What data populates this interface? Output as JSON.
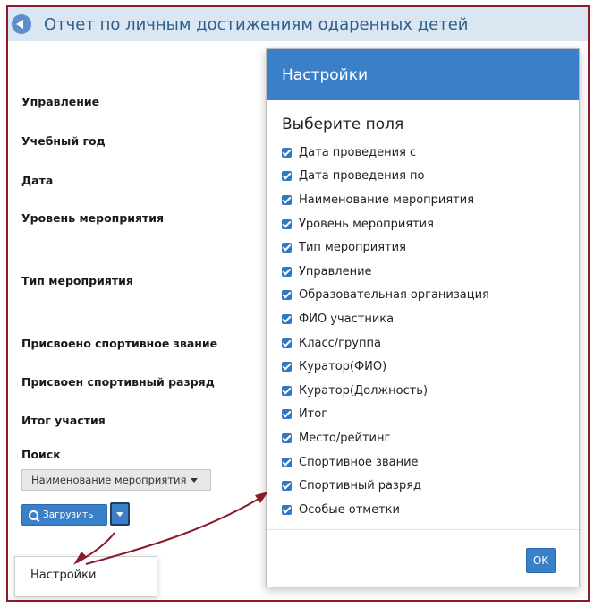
{
  "report": {
    "title": "Отчет по личным достижениям одаренных детей"
  },
  "form": {
    "labels": [
      "Управление",
      "Учебный год",
      "Дата",
      "Уровень мероприятия",
      "Тип мероприятия",
      "Присвоено спортивное звание",
      "Присвоен спортивный разряд",
      "Итог участия",
      "Поиск"
    ],
    "search_field": "Наименование мероприятия",
    "load_button": "Загрузить"
  },
  "dropdown_menu": {
    "items": [
      "Настройки"
    ]
  },
  "modal": {
    "title": "Настройки",
    "section_title": "Выберите поля",
    "fields": [
      {
        "label": "Дата проведения с",
        "checked": true
      },
      {
        "label": "Дата проведения по",
        "checked": true
      },
      {
        "label": "Наименование мероприятия",
        "checked": true
      },
      {
        "label": "Уровень мероприятия",
        "checked": true
      },
      {
        "label": "Тип мероприятия",
        "checked": true
      },
      {
        "label": "Управление",
        "checked": true
      },
      {
        "label": "Образовательная организация",
        "checked": true
      },
      {
        "label": "ФИО участника",
        "checked": true
      },
      {
        "label": "Класс/группа",
        "checked": true
      },
      {
        "label": "Куратор(ФИО)",
        "checked": true
      },
      {
        "label": "Куратор(Должность)",
        "checked": true
      },
      {
        "label": "Итог",
        "checked": true
      },
      {
        "label": "Место/рейтинг",
        "checked": true
      },
      {
        "label": "Спортивное звание",
        "checked": true
      },
      {
        "label": "Спортивный разряд",
        "checked": true
      },
      {
        "label": "Особые отметки",
        "checked": true
      }
    ],
    "ok_button": "OK"
  },
  "colors": {
    "accent": "#3a80c8",
    "title_bar": "#dbe6f3",
    "annotation": "#8b1a2b"
  },
  "icons": [
    "back-icon",
    "search-icon",
    "chevron-down-icon",
    "checkbox-checked-icon",
    "annotation-arrow"
  ]
}
